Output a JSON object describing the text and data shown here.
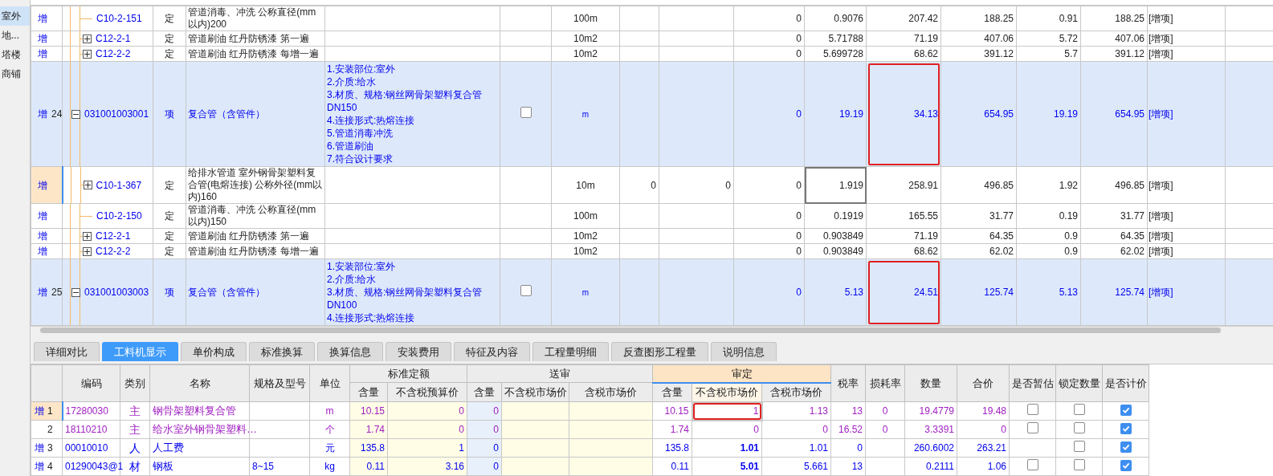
{
  "sidebar": {
    "items": [
      {
        "label": "室外",
        "selected": true
      },
      {
        "label": "地...",
        "selected": false
      },
      {
        "label": "塔楼",
        "selected": false
      },
      {
        "label": "商铺",
        "selected": false
      }
    ]
  },
  "top_rows": [
    {
      "kind": "norm",
      "mark": "增",
      "selected": false,
      "code": "C10-2-151",
      "type": "定",
      "name": "管道消毒、冲洗 公称直径(mm以内)200",
      "unit": "100m",
      "column_10": "0",
      "column_11": "0.9076",
      "column_12": "207.42",
      "column_13": "188.25",
      "column_14": "0.91",
      "column_15": "188.25",
      "tag": "[增项]"
    },
    {
      "kind": "norm",
      "mark": "增",
      "selected": false,
      "expanded": false,
      "code": "C12-2-1",
      "type": "定",
      "name": "管道刷油 红丹防锈漆 第一遍",
      "unit": "10m2",
      "column_10": "0",
      "column_11": "5.71788",
      "column_12": "71.19",
      "column_13": "407.06",
      "column_14": "5.72",
      "column_15": "407.06",
      "tag": "[增项]"
    },
    {
      "kind": "norm",
      "mark": "增",
      "selected": false,
      "expanded": false,
      "code": "C12-2-2",
      "type": "定",
      "name": "管道刷油 红丹防锈漆 每增一遍",
      "unit": "10m2",
      "column_10": "0",
      "column_11": "5.699728",
      "column_12": "68.62",
      "column_13": "391.12",
      "column_14": "5.7",
      "column_15": "391.12",
      "tag": "[增项]"
    },
    {
      "kind": "item",
      "mark": "增",
      "no": "24",
      "selected": false,
      "expanded": true,
      "code": "031001003001",
      "type": "项",
      "name": "复合管（含管件）",
      "features": [
        "1.安装部位:室外",
        "2.介质:给水",
        "3.材质、规格:钢丝网骨架塑料复合管DN150",
        "4.连接形式:热熔连接",
        "5.管道消毒冲洗",
        "6.管道刷油",
        "7.符合设计要求"
      ],
      "checked": false,
      "unit": "m",
      "column_10": "0",
      "column_11": "19.19",
      "column_12": "34.13",
      "column_13": "654.95",
      "column_14": "19.19",
      "column_15": "654.95",
      "highlighted": true,
      "tag": "[增项]"
    },
    {
      "kind": "norm",
      "mark": "增",
      "selected": true,
      "expanded": false,
      "code": "C10-1-367",
      "type": "定",
      "name": "给排水管道 室外钢骨架塑料复合管(电熔连接) 公称外径(mm以内)160",
      "unit": "10m",
      "column_8": "0",
      "column_9": "0",
      "column_10": "0",
      "column_11": "1.919",
      "column_12": "258.91",
      "column_13": "496.85",
      "column_14": "1.92",
      "column_15": "496.85",
      "focused": true,
      "tag": "[增项]"
    },
    {
      "kind": "norm",
      "mark": "增",
      "selected": false,
      "code": "C10-2-150",
      "type": "定",
      "name": "管道消毒、冲洗 公称直径(mm以内)150",
      "unit": "100m",
      "column_10": "0",
      "column_11": "0.1919",
      "column_12": "165.55",
      "column_13": "31.77",
      "column_14": "0.19",
      "column_15": "31.77",
      "tag": "[增项]"
    },
    {
      "kind": "norm",
      "mark": "增",
      "selected": false,
      "expanded": false,
      "code": "C12-2-1",
      "type": "定",
      "name": "管道刷油 红丹防锈漆 第一遍",
      "unit": "10m2",
      "column_10": "0",
      "column_11": "0.903849",
      "column_12": "71.19",
      "column_13": "64.35",
      "column_14": "0.9",
      "column_15": "64.35",
      "tag": "[增项]"
    },
    {
      "kind": "norm",
      "mark": "增",
      "selected": false,
      "expanded": false,
      "code": "C12-2-2",
      "type": "定",
      "name": "管道刷油 红丹防锈漆 每增一遍",
      "unit": "10m2",
      "column_10": "0",
      "column_11": "0.903849",
      "column_12": "68.62",
      "column_13": "62.02",
      "column_14": "0.9",
      "column_15": "62.02",
      "tag": "[增项]"
    },
    {
      "kind": "item",
      "mark": "增",
      "no": "25",
      "selected": false,
      "expanded": true,
      "code": "031001003003",
      "type": "项",
      "name": "复合管（含管件）",
      "features": [
        "1.安装部位:室外",
        "2.介质:给水",
        "3.材质、规格:钢丝网骨架塑料复合管DN100",
        "4.连接形式:热熔连接"
      ],
      "checked": false,
      "unit": "m",
      "column_10": "0",
      "column_11": "5.13",
      "column_12": "24.51",
      "column_13": "125.74",
      "column_14": "5.13",
      "column_15": "125.74",
      "highlighted": true,
      "tag": "[增项]"
    }
  ],
  "tabs": [
    {
      "label": "详细对比",
      "selected": false
    },
    {
      "label": "工料机显示",
      "selected": true
    },
    {
      "label": "单价构成",
      "selected": false
    },
    {
      "label": "标准换算",
      "selected": false
    },
    {
      "label": "换算信息",
      "selected": false
    },
    {
      "label": "安装费用",
      "selected": false
    },
    {
      "label": "特征及内容",
      "selected": false
    },
    {
      "label": "工程量明细",
      "selected": false
    },
    {
      "label": "反查图形工程量",
      "selected": false
    },
    {
      "label": "说明信息",
      "selected": false
    }
  ],
  "columns": [
    {
      "label": "编码"
    },
    {
      "label": "类别"
    },
    {
      "label": "名称"
    },
    {
      "label": "规格及型号"
    },
    {
      "label": "单位"
    },
    {
      "group": "标准定额",
      "selected": false,
      "columns": [
        {
          "label": "含量",
          "selected": false
        },
        {
          "label": "不含税预算价",
          "selected": false
        }
      ]
    },
    {
      "group": "送审",
      "selected": false,
      "columns": [
        {
          "label": "含量",
          "selected": false
        },
        {
          "label": "不含税市场价",
          "selected": false
        },
        {
          "label": "含税市场价",
          "selected": false
        }
      ]
    },
    {
      "group": "审定",
      "selected": true,
      "columns": [
        {
          "label": "含量",
          "selected": false
        },
        {
          "label": "不含税市场价",
          "selected": true
        },
        {
          "label": "含税市场价",
          "selected": false
        }
      ]
    },
    {
      "label": "税率"
    },
    {
      "label": "损耗率"
    },
    {
      "label": "数量"
    },
    {
      "label": "合价"
    },
    {
      "label": "是否暂估"
    },
    {
      "label": "锁定数量"
    },
    {
      "label": "是否计价"
    }
  ],
  "rows": [
    {
      "kind": "main",
      "mark": "增",
      "no": "1",
      "selected": true,
      "code": "17280030",
      "category": "主",
      "name": "钢骨架塑料复合管",
      "unit": "m",
      "std_qty": "10.15",
      "std_price": "0",
      "sub_qty": "0",
      "qty": "10.15",
      "price_ex": "1",
      "price_bold": false,
      "highlighted": true,
      "price_in": "1.13",
      "tax_rate": "13",
      "loss_rate": "0",
      "amount": "19.4779",
      "total": "19.48",
      "tentative": false,
      "locked": false,
      "priced": true
    },
    {
      "kind": "main",
      "no": "2",
      "selected": false,
      "code": "18110210",
      "category": "主",
      "name": "给水室外钢骨架塑料…",
      "unit": "个",
      "std_qty": "1.74",
      "std_price": "0",
      "sub_qty": "0",
      "qty": "1.74",
      "price_ex": "0",
      "price_bold": false,
      "highlighted": false,
      "price_in": "0",
      "tax_rate": "16.52",
      "loss_rate": "0",
      "amount": "3.3391",
      "total": "0",
      "tentative": false,
      "locked": false,
      "priced": true
    },
    {
      "kind": "plain",
      "mark": "增",
      "no": "3",
      "selected": false,
      "code": "00010010",
      "category": "人",
      "name": "人工费",
      "unit": "元",
      "std_qty": "135.8",
      "std_price": "1",
      "sub_qty": "0",
      "qty": "135.8",
      "price_ex": "1.01",
      "price_bold": true,
      "highlighted": false,
      "price_in": "1.01",
      "tax_rate": "0",
      "amount": "260.6002",
      "total": "263.21",
      "locked": false,
      "priced": true
    },
    {
      "kind": "plain",
      "mark": "增",
      "no": "4",
      "selected": false,
      "code": "01290043@1",
      "category": "材",
      "name": "钢板",
      "spec": "8~15",
      "unit": "kg",
      "std_qty": "0.11",
      "std_price": "3.16",
      "sub_qty": "0",
      "qty": "0.11",
      "price_ex": "5.01",
      "price_bold": true,
      "highlighted": false,
      "price_in": "5.661",
      "tax_rate": "13",
      "amount": "0.2111",
      "total": "1.06",
      "tentative": false,
      "locked": false,
      "priced": true
    }
  ]
}
